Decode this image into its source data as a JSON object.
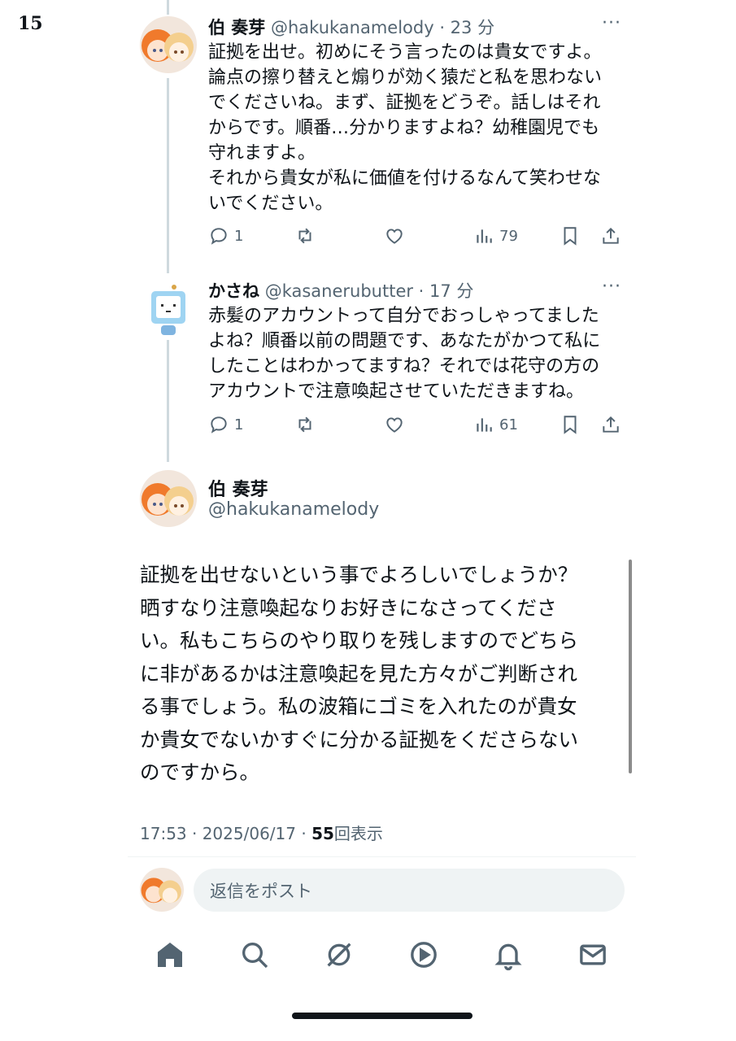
{
  "page_number": "15",
  "tweets": [
    {
      "name": "伯 奏芽",
      "meta": "@hakukanamelody · 23 分",
      "body": "証拠を出せ。初めにそう言ったのは貴女ですよ。\n論点の擦り替えと煽りが効く猿だと私を思わない\nでくださいね。まず、証拠をどうぞ。話しはそれ\nからです。順番…分かりますよね？幼稚園児でも\n守れますよ。\nそれから貴女が私に価値を付けるなんて笑わせな\nいでください。",
      "replies": "1",
      "views": "79"
    },
    {
      "name": "かさね",
      "meta": "@kasanerubutter · 17 分",
      "body": "赤髪のアカウントって自分でおっしゃってました\nよね？順番以前の問題です、あなたがかつて私に\nしたことはわかってますね？それでは花守の方の\nアカウントで注意喚起させていただきますね。",
      "replies": "1",
      "views": "61"
    }
  ],
  "main": {
    "name": "伯 奏芽",
    "handle": "@hakukanamelody",
    "body": "証拠を出せないという事でよろしいでしょうか？\n晒すなり注意喚起なりお好きになさってくださ\nい。私もこちらのやり取りを残しますのでどちら\nに非があるかは注意喚起を見た方々がご判断され\nる事でしょう。私の波箱にゴミを入れたのが貴女\nか貴女でないかすぐに分かる証拠をくださらない\nのですから。",
    "time": "17:53 · 2025/06/17 · ",
    "views": "55",
    "views_label": "回表示"
  },
  "reply_placeholder": "返信をポスト",
  "more_glyph": "···",
  "nav": [
    "home-icon",
    "search-icon",
    "grok-icon",
    "video-icon",
    "notifications-icon",
    "messages-icon"
  ]
}
